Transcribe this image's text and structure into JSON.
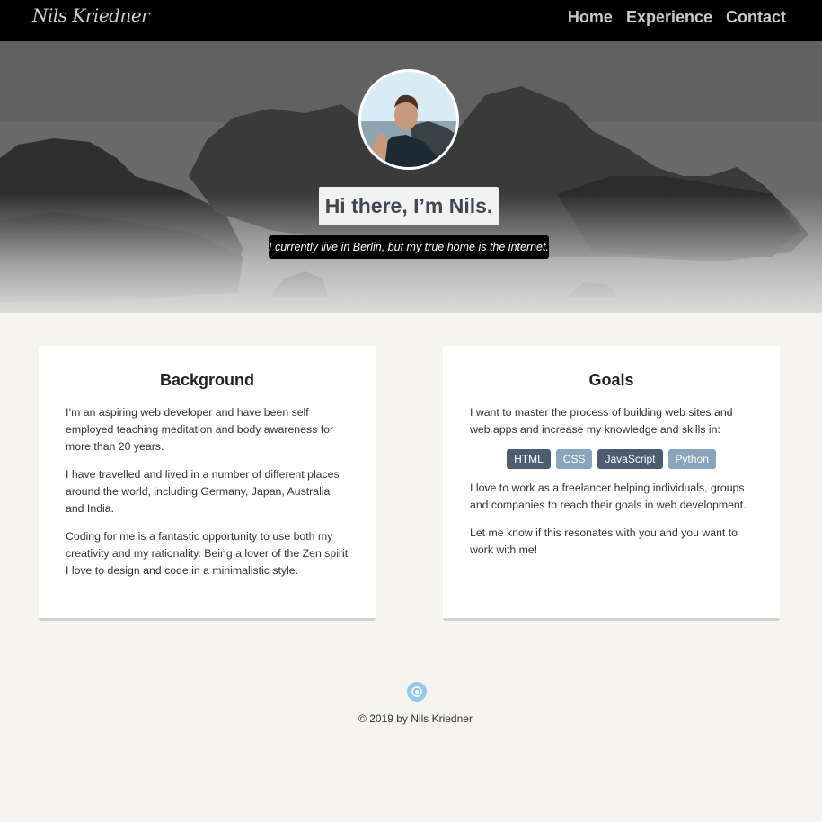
{
  "header": {
    "logo": "Nils Kriedner",
    "nav": [
      "Home",
      "Experience",
      "Contact"
    ]
  },
  "hero": {
    "title": "Hi there, I’m Nils.",
    "subtitle": "I currently live in Berlin, but my true home is the internet."
  },
  "background": {
    "heading": "Background",
    "paragraphs": [
      "I’m an aspiring web developer and have been self employed teaching meditation and body awareness for more than 20 years.",
      "I have travelled and lived in a number of different places around the world, including Germany, Japan, Australia and India.",
      "Coding for me is a fantastic opportunity to use both my creativity and my rationality. Being a lover of the Zen spirit I love to design and code in a minimalistic style."
    ]
  },
  "goals": {
    "heading": "Goals",
    "intro": "I want to master the process of building web sites and web apps and increase my knowledge and skills in:",
    "skills": [
      {
        "label": "HTML",
        "color": "#4b5d6e"
      },
      {
        "label": "CSS",
        "color": "#8aa4bd"
      },
      {
        "label": "JavaScript",
        "color": "#4b5d6e"
      },
      {
        "label": "Python",
        "color": "#8aa4bd"
      }
    ],
    "paragraphs": [
      "I love to work as a freelancer helping individuals, groups and companies to reach their goals in web development.",
      "Let me know if this resonates with you and you want to work with me!"
    ]
  },
  "footer": {
    "icon": "logo-icon",
    "copyright": "© 2019 by Nils Kriedner"
  }
}
